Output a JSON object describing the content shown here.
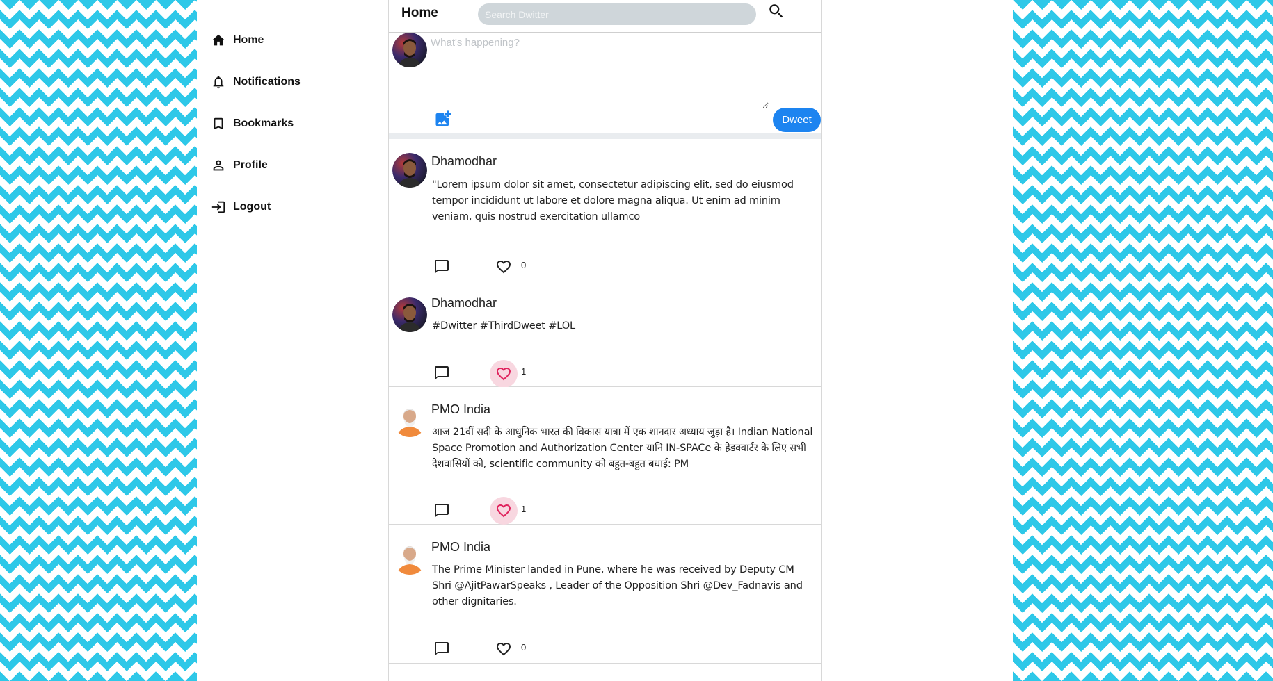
{
  "sidebar": {
    "items": [
      {
        "label": "Home",
        "icon": "home-icon"
      },
      {
        "label": "Notifications",
        "icon": "bell-icon"
      },
      {
        "label": "Bookmarks",
        "icon": "bookmark-icon"
      },
      {
        "label": "Profile",
        "icon": "person-icon"
      },
      {
        "label": "Logout",
        "icon": "logout-icon"
      }
    ]
  },
  "header": {
    "title": "Home",
    "search_placeholder": "Search Dwitter"
  },
  "composer": {
    "placeholder": "What's happening?",
    "dweet_label": "Dweet"
  },
  "tweets": [
    {
      "author": "Dhamodhar",
      "text": "\"Lorem ipsum dolor sit amet, consectetur adipiscing elit, sed do eiusmod tempor incididunt ut labore et dolore magna aliqua. Ut enim ad minim veniam, quis nostrud exercitation ullamco",
      "likes": "0",
      "liked": false
    },
    {
      "author": "Dhamodhar",
      "text": "#Dwitter #ThirdDweet #LOL",
      "likes": "1",
      "liked": true
    },
    {
      "author": "PMO India",
      "text": "आज 21वीं सदी के आधुनिक भारत की विकास यात्रा में एक शानदार अध्याय जुड़ा है। Indian National Space Promotion and Authorization Center यानि IN-SPACe के हेडक्वार्टर के लिए सभी देशवासियों को, scientific community को बहुत-बहुत बधाई: PM",
      "likes": "1",
      "liked": true
    },
    {
      "author": "PMO India",
      "text": "The Prime Minister landed in Pune, where he was received by Deputy CM Shri @AjitPawarSpeaks , Leader of the Opposition Shri @Dev_Fadnavis and other dignitaries.",
      "likes": "0",
      "liked": false
    }
  ],
  "colors": {
    "accent": "#1d84f0",
    "pattern": "#2ec8e8",
    "liked_bg": "#f8d7e0",
    "liked_heart": "#e0245e"
  }
}
